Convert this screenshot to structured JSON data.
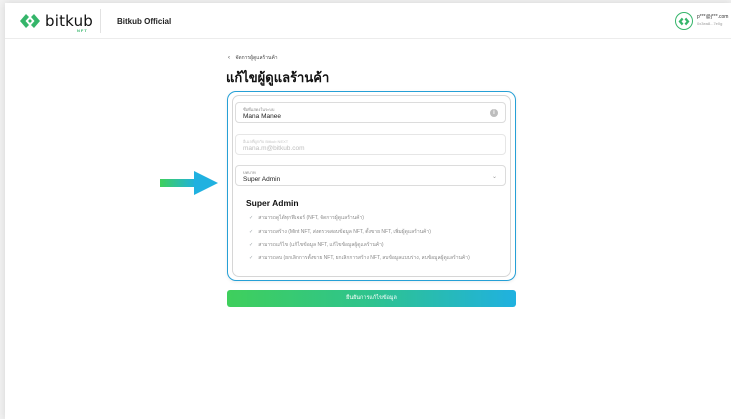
{
  "header": {
    "logo_text": "bitkub",
    "logo_sub": "NFT",
    "shop_name": "Bitkub Official",
    "user_email": "p***@j***.com",
    "user_sub": "0x3ea8...7e0g"
  },
  "breadcrumb": {
    "back_label": "จัดการผู้ดูแลร้านค้า"
  },
  "page_title": "แก้ไขผู้ดูแลร้านค้า",
  "form": {
    "name_label": "ชื่อที่แสดงในระบบ",
    "name_value": "Mana Manee",
    "email_label": "อีเมลที่ผูกกับ Bitkub NEXT",
    "email_value": "mana.m@bitkub.com",
    "role_label": "บทบาท",
    "role_value": "Super Admin"
  },
  "role": {
    "title": "Super Admin",
    "permissions": [
      "สามารถดูได้ทุกฟีเจอร์ (NFT, จัดการผู้ดูแลร้านค้า)",
      "สามารถสร้าง (Mint NFT, ส่งตรวจสอบข้อมูล NFT, ตั้งขาย NFT, เพิ่มผู้ดูแลร้านค้า)",
      "สามารถแก้ไข (แก้ไขข้อมูล NFT, แก้ไขข้อมูลผู้ดูแลร้านค้า)",
      "สามารถลบ (ยกเลิกการตั้งขาย NFT, ยกเลิกการสร้าง NFT, ลบข้อมูลแบบร่าง, ลบข้อมูลผู้ดูแลร้านค้า)"
    ]
  },
  "confirm_label": "ยืนยันการแก้ไขข้อมูล",
  "colors": {
    "brand_green": "#35b56a",
    "card_border": "#26a0d6",
    "arrow_start": "#3fcf5c",
    "arrow_end": "#20b1e0"
  },
  "icons": [
    "bitkub-logo-icon",
    "info-icon",
    "chevron-left-icon",
    "chevron-down-icon",
    "check-icon",
    "arrow-right-icon",
    "avatar-icon"
  ]
}
